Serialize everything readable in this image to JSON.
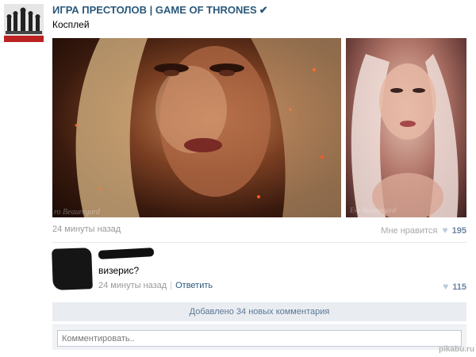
{
  "post": {
    "group_name": "ИГРА ПРЕСТОЛОВ | GAME OF THRONES",
    "verified_icon": "checkmark-icon",
    "verified_glyph": "✔",
    "text": "Косплей",
    "photos": [
      {
        "watermark": "ro Beauregard"
      },
      {
        "watermark": "Eve Beauregard"
      }
    ],
    "time": "24 минуты назад",
    "like_label": "Мне нравится",
    "heart_glyph": "♥",
    "like_count": "195"
  },
  "comment": {
    "text": "визерис?",
    "time": "24 минуты назад",
    "separator": "|",
    "reply_label": "Ответить",
    "heart_glyph": "♥",
    "like_count": "115"
  },
  "more_comments_label": "Добавлено 34 новых комментария",
  "comment_box": {
    "placeholder": "Комментировать.."
  },
  "site_watermark": "pikabu.ru",
  "colors": {
    "link": "#2b587a",
    "like_count": "#6b85a3",
    "bar": "#e9edf1"
  }
}
